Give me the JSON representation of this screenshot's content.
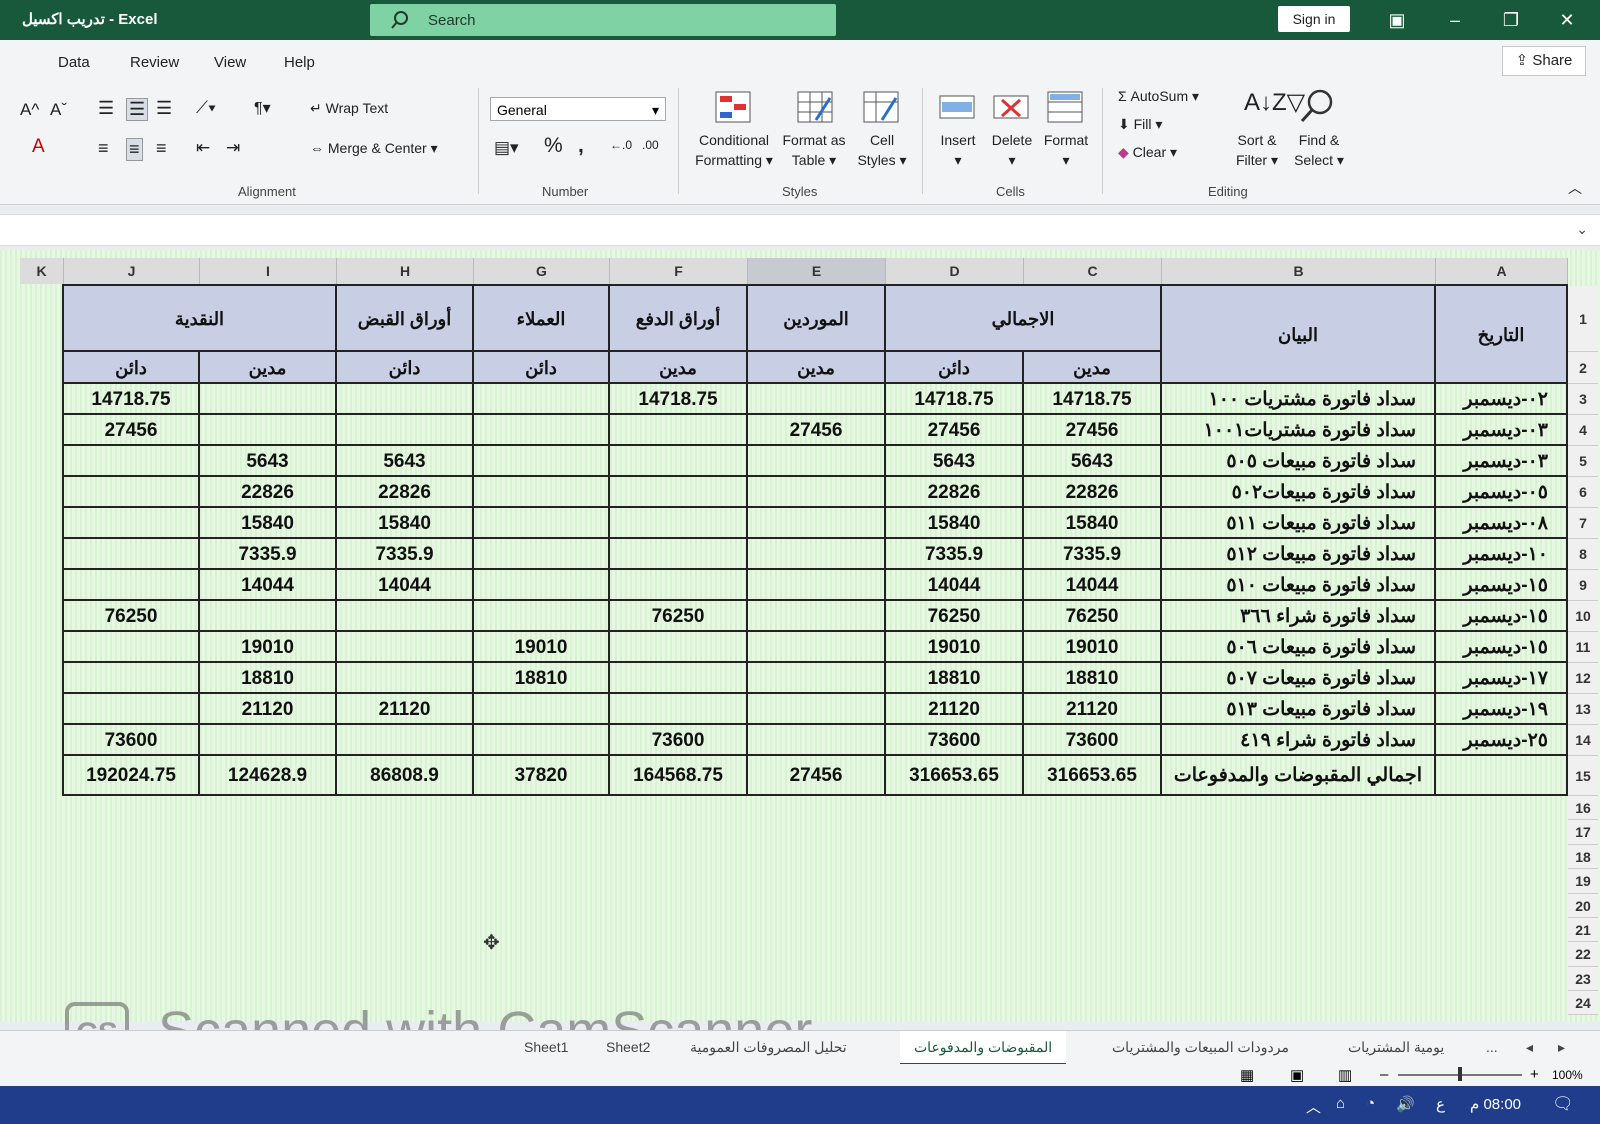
{
  "titlebar": {
    "title": "تدريب اكسيل - Excel",
    "search_label": "Search",
    "signin_label": "Sign in"
  },
  "menu": {
    "items": [
      "Data",
      "Review",
      "View",
      "Help"
    ],
    "share_label": "Share"
  },
  "ribbon": {
    "wrap_text": "Wrap Text",
    "merge_center": "Merge & Center",
    "alignment_label": "Alignment",
    "number_format": "General",
    "number_label": "Number",
    "conditional_formatting": [
      "Conditional",
      "Formatting"
    ],
    "format_as_table": [
      "Format as",
      "Table"
    ],
    "cell_styles": [
      "Cell",
      "Styles"
    ],
    "styles_label": "Styles",
    "insert": "Insert",
    "delete": "Delete",
    "format": "Format",
    "cells_label": "Cells",
    "autosum": "AutoSum",
    "fill": "Fill",
    "clear": "Clear",
    "sort_filter": [
      "Sort &",
      "Filter"
    ],
    "find_select": [
      "Find &",
      "Select"
    ],
    "editing_label": "Editing"
  },
  "columns": [
    "K",
    "J",
    "I",
    "H",
    "G",
    "F",
    "E",
    "D",
    "C",
    "B",
    "A"
  ],
  "rows": [
    "1",
    "2",
    "3",
    "4",
    "5",
    "6",
    "7",
    "8",
    "9",
    "10",
    "11",
    "12",
    "13",
    "14",
    "15",
    "16",
    "17",
    "18",
    "19",
    "20",
    "21",
    "22",
    "23",
    "24"
  ],
  "table": {
    "group_headers": {
      "date": "التاريخ",
      "statement": "البيان",
      "total": "الاجمالي",
      "suppliers": "الموردين",
      "payables": "أوراق الدفع",
      "customers": "العملاء",
      "receivables": "أوراق القبض",
      "cash": "النقدية"
    },
    "sub_headers": {
      "total_debit": "مدين",
      "total_credit": "دائن",
      "suppliers": "مدين",
      "payables": "مدين",
      "customers": "دائن",
      "receivables": "دائن",
      "cash_debit": "مدين",
      "cash_credit": "دائن"
    },
    "data_rows": [
      {
        "date": "٠٢-ديسمبر",
        "desc": "سداد فاتورة مشتريات ١٠٠",
        "total_debit": "14718.75",
        "total_credit": "14718.75",
        "suppliers": "",
        "payables": "14718.75",
        "customers": "",
        "receivables": "",
        "cash_debit": "",
        "cash_credit": "14718.75"
      },
      {
        "date": "٠٣-ديسمبر",
        "desc": "سداد فاتورة مشتريات١٠٠١",
        "total_debit": "27456",
        "total_credit": "27456",
        "suppliers": "27456",
        "payables": "",
        "customers": "",
        "receivables": "",
        "cash_debit": "",
        "cash_credit": "27456"
      },
      {
        "date": "٠٣-ديسمبر",
        "desc": "سداد فاتورة مبيعات ٥٠٥",
        "total_debit": "5643",
        "total_credit": "5643",
        "suppliers": "",
        "payables": "",
        "customers": "",
        "receivables": "5643",
        "cash_debit": "5643",
        "cash_credit": ""
      },
      {
        "date": "٠٥-ديسمبر",
        "desc": "سداد فاتورة مبيعات٥٠٢",
        "total_debit": "22826",
        "total_credit": "22826",
        "suppliers": "",
        "payables": "",
        "customers": "",
        "receivables": "22826",
        "cash_debit": "22826",
        "cash_credit": ""
      },
      {
        "date": "٠٨-ديسمبر",
        "desc": "سداد فاتورة مبيعات ٥١١",
        "total_debit": "15840",
        "total_credit": "15840",
        "suppliers": "",
        "payables": "",
        "customers": "",
        "receivables": "15840",
        "cash_debit": "15840",
        "cash_credit": ""
      },
      {
        "date": "١٠-ديسمبر",
        "desc": "سداد فاتورة مبيعات ٥١٢",
        "total_debit": "7335.9",
        "total_credit": "7335.9",
        "suppliers": "",
        "payables": "",
        "customers": "",
        "receivables": "7335.9",
        "cash_debit": "7335.9",
        "cash_credit": ""
      },
      {
        "date": "١٥-ديسمبر",
        "desc": "سداد فاتورة مبيعات ٥١٠",
        "total_debit": "14044",
        "total_credit": "14044",
        "suppliers": "",
        "payables": "",
        "customers": "",
        "receivables": "14044",
        "cash_debit": "14044",
        "cash_credit": ""
      },
      {
        "date": "١٥-ديسمبر",
        "desc": "سداد فاتورة شراء ٣٦٦",
        "total_debit": "76250",
        "total_credit": "76250",
        "suppliers": "",
        "payables": "76250",
        "customers": "",
        "receivables": "",
        "cash_debit": "",
        "cash_credit": "76250"
      },
      {
        "date": "١٥-ديسمبر",
        "desc": "سداد فاتورة مبيعات ٥٠٦",
        "total_debit": "19010",
        "total_credit": "19010",
        "suppliers": "",
        "payables": "",
        "customers": "19010",
        "receivables": "",
        "cash_debit": "19010",
        "cash_credit": ""
      },
      {
        "date": "١٧-ديسمبر",
        "desc": "سداد فاتورة مبيعات ٥٠٧",
        "total_debit": "18810",
        "total_credit": "18810",
        "suppliers": "",
        "payables": "",
        "customers": "18810",
        "receivables": "",
        "cash_debit": "18810",
        "cash_credit": ""
      },
      {
        "date": "١٩-ديسمبر",
        "desc": "سداد فاتورة مبيعات ٥١٣",
        "total_debit": "21120",
        "total_credit": "21120",
        "suppliers": "",
        "payables": "",
        "customers": "",
        "receivables": "21120",
        "cash_debit": "21120",
        "cash_credit": ""
      },
      {
        "date": "٢٥-ديسمبر",
        "desc": "سداد فاتورة شراء ٤١٩",
        "total_debit": "73600",
        "total_credit": "73600",
        "suppliers": "",
        "payables": "73600",
        "customers": "",
        "receivables": "",
        "cash_debit": "",
        "cash_credit": "73600"
      }
    ],
    "totals": {
      "date": "",
      "desc": "اجمالي المقبوضات والمدفوعات",
      "total_debit": "316653.65",
      "total_credit": "316653.65",
      "suppliers": "27456",
      "payables": "164568.75",
      "customers": "37820",
      "receivables": "86808.9",
      "cash_debit": "124628.9",
      "cash_credit": "192024.75"
    }
  },
  "tabs": {
    "items": [
      "يومية المشتريات",
      "مردودات المبيعات والمشتريات",
      "المقبوضات والمدفوعات",
      "تحليل المصروفات العمومية",
      "Sheet2",
      "Sheet1"
    ],
    "active": "المقبوضات والمدفوعات",
    "more": "..."
  },
  "status": {
    "zoom": "100%"
  },
  "taskbar": {
    "time": "08:00 م",
    "lang": "ع"
  },
  "watermark": {
    "logo": "CS",
    "text": "Scanned with CamScanner"
  }
}
